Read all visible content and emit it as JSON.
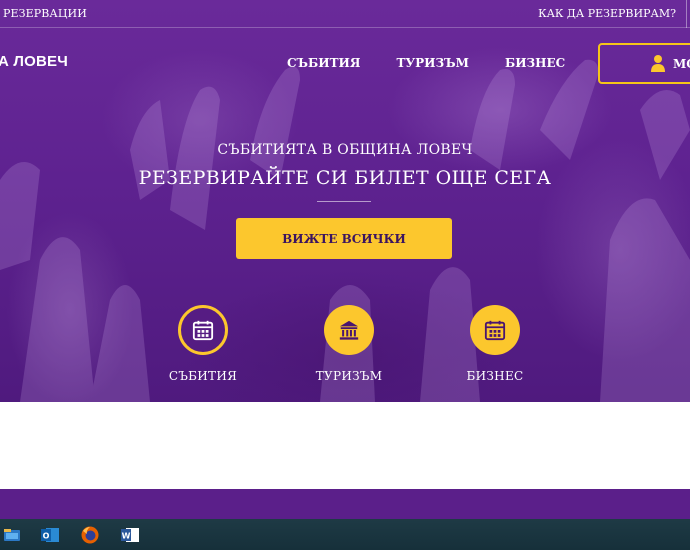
{
  "topbar": {
    "left_link": "РЕЗЕРВАЦИИ",
    "right_link": "КАК ДА РЕЗЕРВИРАМ?"
  },
  "header": {
    "logo_text": "А ЛОВЕЧ",
    "nav": [
      {
        "label": "СЪБИТИЯ"
      },
      {
        "label": "ТУРИЗЪМ"
      },
      {
        "label": "БИЗНЕС"
      }
    ],
    "account_label": "МО",
    "account_icon": "user-icon"
  },
  "hero": {
    "subtitle": "СЪБИТИЯТА В ОБЩИНА ЛОВЕЧ",
    "title": "РЕЗЕРВИРАЙТЕ СИ БИЛЕТ ОЩЕ СЕГА",
    "cta_label": "ВИЖТЕ ВСИЧКИ",
    "categories": [
      {
        "label": "СЪБИТИЯ",
        "icon": "calendar-icon"
      },
      {
        "label": "ТУРИЗЪМ",
        "icon": "museum-icon"
      },
      {
        "label": "БИЗНЕС",
        "icon": "calendar-icon"
      }
    ]
  },
  "colors": {
    "brand_purple": "#5e2290",
    "accent_yellow": "#fcc72d",
    "taskbar": "#1e3a45"
  },
  "taskbar": {
    "icons": [
      "file-explorer-icon",
      "outlook-icon",
      "firefox-icon",
      "word-icon"
    ]
  }
}
